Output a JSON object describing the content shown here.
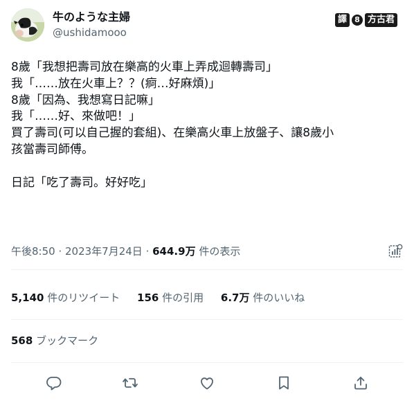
{
  "author": {
    "display_name": "牛のような主婦",
    "handle": "@ushidamooo"
  },
  "watermark": {
    "left": "譯",
    "badge": "8",
    "right": "方古君"
  },
  "tweet": {
    "lines": [
      "8歲「我想把壽司放在樂高的火車上弄成迴轉壽司」",
      "我「……放在火車上？？(痾…好麻煩)」",
      "8歲「因為、我想寫日記嘛」",
      "我「……好、來做吧！」",
      "買了壽司(可以自己握的套組)、在樂高火車上放盤子、讓8歲小",
      "孩當壽司師傅。",
      "",
      "日記「吃了壽司。好好吃」"
    ]
  },
  "meta": {
    "time": "午後8:50",
    "sep1": " · ",
    "date": "2023年7月24日",
    "sep2": " · ",
    "views_count": "644.9万",
    "views_label": " 件の表示"
  },
  "stats": {
    "retweets_count": "5,140",
    "retweets_label": " 件のリツイート",
    "quotes_count": "156",
    "quotes_label": " 件の引用",
    "likes_count": "6.7万",
    "likes_label": " 件のいいね"
  },
  "bookmarks": {
    "count": "568",
    "label": " ブックマーク"
  },
  "icons": {
    "reply": "reply-icon",
    "retweet": "retweet-icon",
    "like": "heart-icon",
    "bookmark": "bookmark-icon",
    "share": "share-icon",
    "analytics": "analytics-icon"
  },
  "colors": {
    "text": "#0f1419",
    "secondary": "#536471",
    "divider": "#eff3f4"
  }
}
